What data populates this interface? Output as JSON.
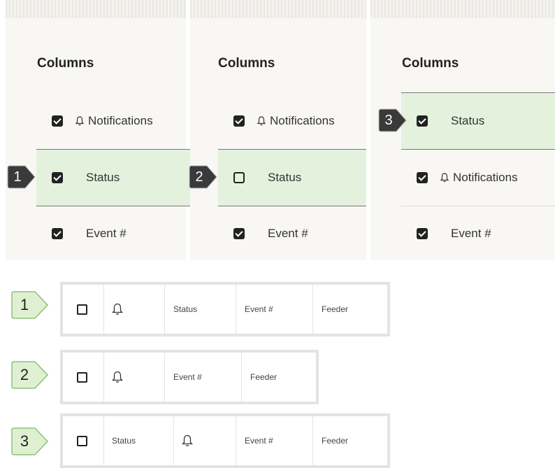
{
  "panels": [
    {
      "title": "Columns",
      "rows": [
        {
          "label": "Notifications",
          "icon": "bell-icon",
          "checked": true,
          "highlighted": false
        },
        {
          "label": "Status",
          "icon": null,
          "checked": true,
          "highlighted": true
        },
        {
          "label": "Event #",
          "icon": null,
          "checked": true,
          "highlighted": false
        }
      ],
      "callout": "1"
    },
    {
      "title": "Columns",
      "rows": [
        {
          "label": "Notifications",
          "icon": "bell-icon",
          "checked": true,
          "highlighted": false
        },
        {
          "label": "Status",
          "icon": null,
          "checked": false,
          "highlighted": true
        },
        {
          "label": "Event #",
          "icon": null,
          "checked": true,
          "highlighted": false
        }
      ],
      "callout": "2"
    },
    {
      "title": "Columns",
      "rows": [
        {
          "label": "Status",
          "icon": null,
          "checked": true,
          "highlighted": true
        },
        {
          "label": "Notifications",
          "icon": "bell-icon",
          "checked": true,
          "highlighted": false
        },
        {
          "label": "Event #",
          "icon": null,
          "checked": true,
          "highlighted": false
        }
      ],
      "callout": "3"
    }
  ],
  "results": [
    {
      "callout": "1",
      "columns": [
        "bell-icon",
        "Status",
        "Event #",
        "Feeder"
      ]
    },
    {
      "callout": "2",
      "columns": [
        "bell-icon",
        "Event #",
        "Feeder"
      ]
    },
    {
      "callout": "3",
      "columns": [
        "Status",
        "bell-icon",
        "Event #",
        "Feeder"
      ]
    }
  ],
  "colors": {
    "highlight": "#e4f2dd",
    "dark_callout": "#3a3a3a",
    "light_callout": "#dff0d2",
    "strip_border": "#e3e3e3"
  }
}
